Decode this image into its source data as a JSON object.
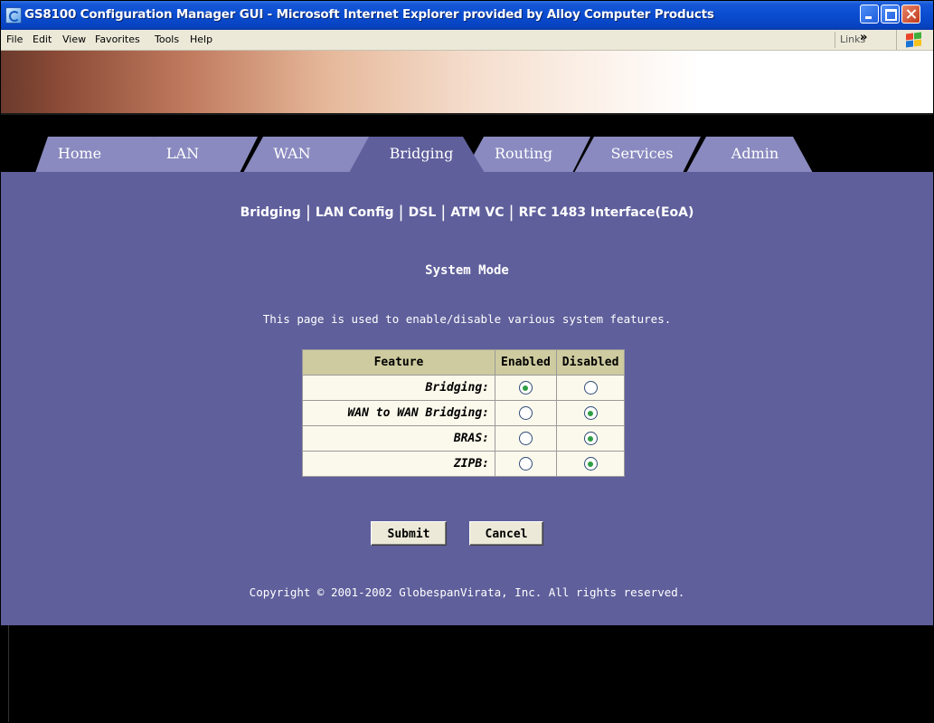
{
  "window": {
    "title": "GS8100 Configuration Manager GUI - Microsoft Internet Explorer provided by Alloy Computer Products",
    "icon": "ie-icon",
    "controls": [
      "minimize",
      "maximize",
      "close"
    ]
  },
  "menubar": {
    "items": [
      "File",
      "Edit",
      "View",
      "Favorites",
      "Tools",
      "Help"
    ],
    "links_label": "Links",
    "links_chevron": "»"
  },
  "tabs": [
    {
      "label": "Home",
      "active": false
    },
    {
      "label": "LAN",
      "active": false
    },
    {
      "label": "WAN",
      "active": false
    },
    {
      "label": "Bridging",
      "active": true
    },
    {
      "label": "Routing",
      "active": false
    },
    {
      "label": "Services",
      "active": false
    },
    {
      "label": "Admin",
      "active": false
    }
  ],
  "subnav": {
    "items": [
      "Bridging",
      "LAN Config",
      "DSL",
      "ATM VC",
      "RFC 1483 Interface(EoA)"
    ],
    "separator": "|"
  },
  "page": {
    "title": "System Mode",
    "description": "This page is used to enable/disable various system features."
  },
  "table": {
    "headers": [
      "Feature",
      "Enabled",
      "Disabled"
    ],
    "rows": [
      {
        "feature": "Bridging:",
        "enabled": true
      },
      {
        "feature": "WAN to WAN Bridging:",
        "enabled": false
      },
      {
        "feature": "BRAS:",
        "enabled": false
      },
      {
        "feature": "ZIPB:",
        "enabled": false
      }
    ]
  },
  "buttons": {
    "submit": "Submit",
    "cancel": "Cancel"
  },
  "footer": {
    "copyright": "Copyright © 2001-2002 GlobespanVirata, Inc. All rights reserved."
  },
  "colors": {
    "content_bg": "#5f5f9c",
    "tab_inactive": "#8a8ac0",
    "tab_active": "#5f5f9c",
    "table_header": "#cecba0",
    "table_cell": "#fbf9ec",
    "radio_selected": "#2f9e44"
  }
}
